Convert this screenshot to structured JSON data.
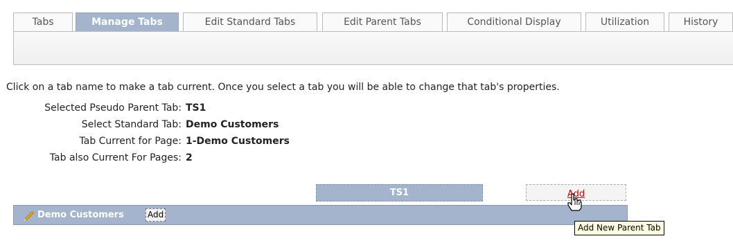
{
  "tabs": [
    {
      "label": "Tabs",
      "active": false
    },
    {
      "label": "Manage Tabs",
      "active": true
    },
    {
      "label": "Edit Standard Tabs",
      "active": false
    },
    {
      "label": "Edit Parent Tabs",
      "active": false
    },
    {
      "label": "Conditional Display",
      "active": false
    },
    {
      "label": "Utilization",
      "active": false
    },
    {
      "label": "History",
      "active": false
    }
  ],
  "instructions": "Click on a tab name to make a tab current. Once you select a tab you will be able to change that tab's properties.",
  "info": [
    {
      "label": "Selected Pseudo Parent Tab:",
      "value": "TS1"
    },
    {
      "label": "Select Standard Tab:",
      "value": "Demo Customers"
    },
    {
      "label": "Tab Current for Page:",
      "value": "1-Demo Customers"
    },
    {
      "label": "Tab also Current For Pages:",
      "value": "2"
    }
  ],
  "parent_tab": {
    "label": "TS1",
    "add_label": "Add"
  },
  "standard_tabs": {
    "tab_label": "Demo Customers",
    "icon": "pencil-icon",
    "add_label": "Add"
  },
  "tooltip": "Add New Parent Tab",
  "colors": {
    "tab_active": "#a3b4cc",
    "link": "#d40000",
    "tooltip_bg": "#ffffe1"
  }
}
